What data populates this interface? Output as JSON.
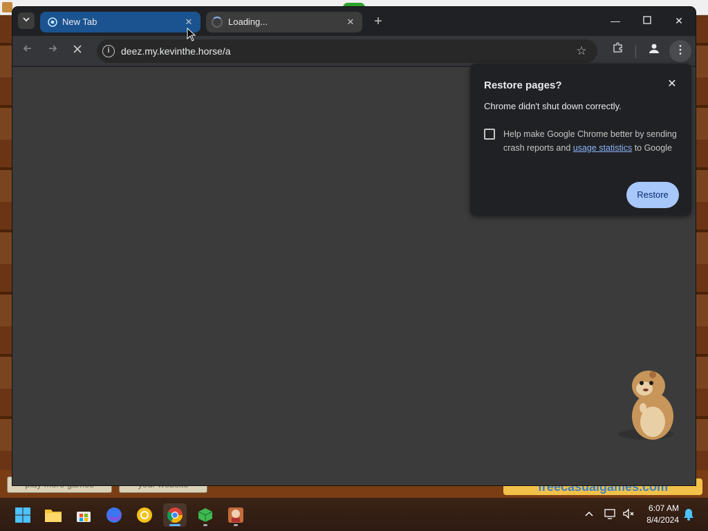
{
  "browser": {
    "tabs": [
      {
        "title": "New Tab",
        "state": "active-selected"
      },
      {
        "title": "Loading...",
        "state": "loading"
      }
    ],
    "url": "deez.my.kevinthe.horse/a"
  },
  "restore_bubble": {
    "title": "Restore pages?",
    "message": "Chrome didn't shut down correctly.",
    "checkbox_text_before": "Help make Google Chrome better by sending crash reports and ",
    "checkbox_link": "usage statistics",
    "checkbox_text_after": " to Google",
    "checkbox_checked": false,
    "restore_button": "Restore"
  },
  "background_game": {
    "button_left": "play more games",
    "button_mid": "your website",
    "logo": "freecasualgames.com"
  },
  "taskbar": {
    "apps": [
      "windows-start",
      "file-explorer",
      "microsoft-store",
      "firefox",
      "yellow-app",
      "chrome",
      "green-dice-app",
      "game-app"
    ],
    "time": "6:07 AM",
    "date": "8/4/2024"
  },
  "colors": {
    "chrome_dark": "#202124",
    "content_bg": "#3b3b3b",
    "accent": "#a8c7fa",
    "link": "#8ab4f8"
  }
}
